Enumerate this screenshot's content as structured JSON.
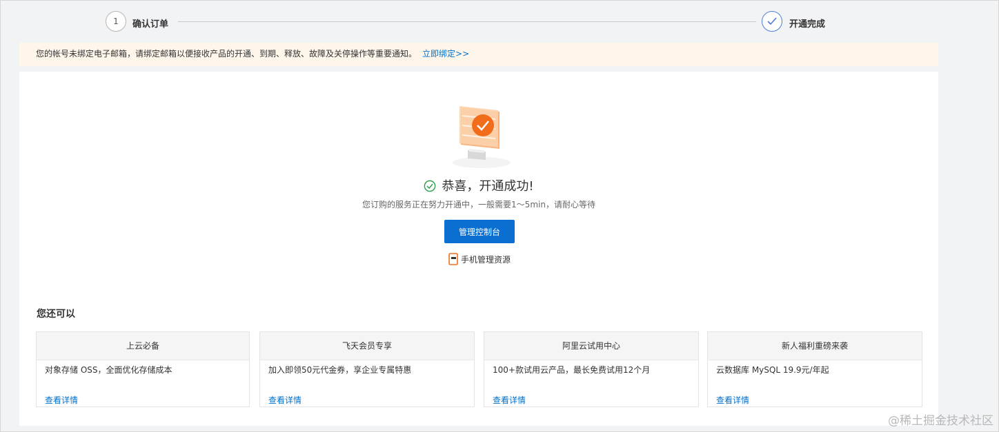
{
  "steps": [
    {
      "number": "1",
      "label": "确认订单",
      "state": "active"
    },
    {
      "label": "开通完成",
      "state": "done"
    }
  ],
  "notice": {
    "text": "您的帐号未绑定电子邮箱，请绑定邮箱以便接收产品的开通、到期、释放、故障及关停操作等重要通知。",
    "link": "立即绑定>>"
  },
  "result": {
    "title": "恭喜，开通成功!",
    "subtitle": "您订购的服务正在努力开通中，一般需要1～5min，请耐心等待",
    "console_button": "管理控制台",
    "mobile_link": "手机管理资源"
  },
  "more": {
    "title": "您还可以",
    "cards": [
      {
        "title": "上云必备",
        "desc": "对象存储 OSS，全面优化存储成本",
        "link": "查看详情"
      },
      {
        "title": "飞天会员专享",
        "desc": "加入即领50元代金券，享企业专属特惠",
        "link": "查看详情"
      },
      {
        "title": "阿里云试用中心",
        "desc": "100+款试用云产品，最长免费试用12个月",
        "link": "查看详情"
      },
      {
        "title": "新人福利重磅来袭",
        "desc": "云数据库 MySQL 19.9元/年起",
        "link": "查看详情"
      }
    ]
  },
  "watermark": "@稀土掘金技术社区",
  "colors": {
    "accent": "#0a6fd1",
    "link": "#0070cc",
    "success": "#2e9e4f",
    "notice_bg": "#fef6eb"
  }
}
